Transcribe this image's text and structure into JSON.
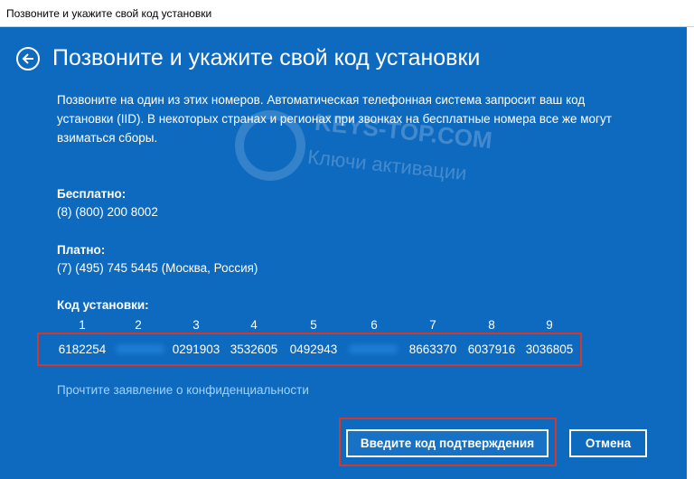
{
  "window": {
    "title": "Позвоните и укажите свой код установки"
  },
  "header": {
    "title": "Позвоните и укажите свой код установки"
  },
  "description": "Позвоните на один из этих номеров. Автоматическая телефонная система запросит ваш код установки (IID). В некоторых странах и регионах при звонках на бесплатные номера все же могут взиматься сборы.",
  "watermark": {
    "title": "KEYS-TOP.COM",
    "subtitle": "Ключи активации"
  },
  "free": {
    "label": "Бесплатно:",
    "number": "(8) (800) 200 8002"
  },
  "paid": {
    "label": "Платно:",
    "number": "(7) (495) 745 5445 (Москва, Россия)"
  },
  "iid": {
    "label": "Код установки:",
    "numbers": [
      "1",
      "2",
      "3",
      "4",
      "5",
      "6",
      "7",
      "8",
      "9"
    ],
    "blocks": [
      "6182254",
      "0000000",
      "0291903",
      "3532605",
      "0492943",
      "0000000",
      "8663370",
      "6037916",
      "3036805"
    ],
    "blurred_blocks": [
      2,
      6
    ]
  },
  "privacy_link": "Прочтите заявление о конфиденциальности",
  "buttons": {
    "confirm": "Введите код подтверждения",
    "cancel": "Отмена"
  },
  "colors": {
    "background": "#0e6abf",
    "highlight": "#d0392b",
    "link": "#9fd3ff"
  }
}
